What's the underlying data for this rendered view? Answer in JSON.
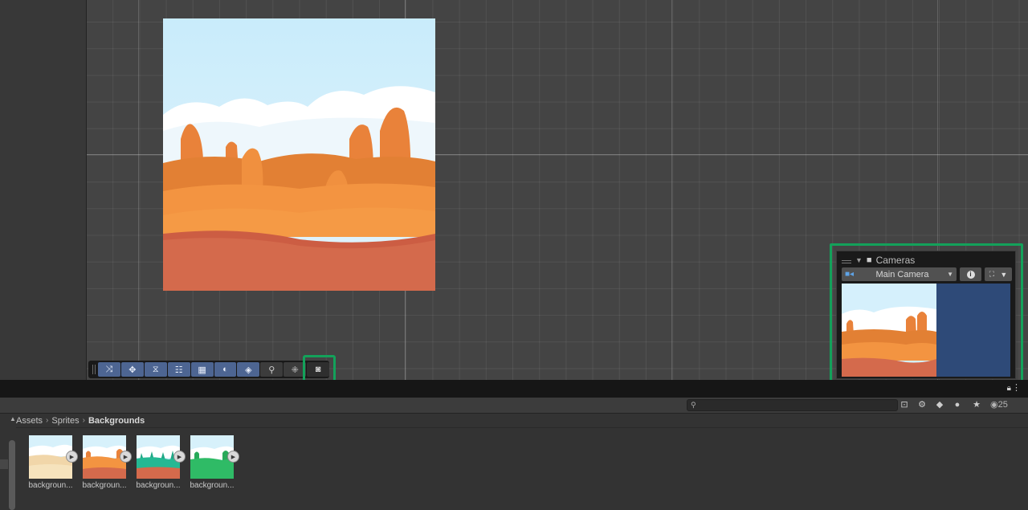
{
  "scene": {
    "toolbar": {
      "tools": [
        {
          "icon": "view-tool-icon",
          "glyph": "⤨",
          "active": true
        },
        {
          "icon": "move-tool-icon",
          "glyph": "✥",
          "active": true
        },
        {
          "icon": "rotate-tool-icon",
          "glyph": "⧖",
          "active": true
        },
        {
          "icon": "rect-tool-icon",
          "glyph": "☷",
          "active": true
        },
        {
          "icon": "grid-snap-icon",
          "glyph": "▦",
          "active": true
        },
        {
          "icon": "shading-mode-icon",
          "glyph": "◐",
          "active": true
        },
        {
          "icon": "gizmos-icon",
          "glyph": "◈",
          "active": true
        },
        {
          "icon": "search-scene-icon",
          "glyph": "⚲",
          "active": false
        },
        {
          "icon": "orientation-icon",
          "glyph": "⁜",
          "active": false
        },
        {
          "icon": "camera-overlay-icon",
          "glyph": "◙",
          "active": false,
          "selected": true
        }
      ]
    },
    "cameras_overlay": {
      "title": "Cameras",
      "selected_camera": "Main Camera",
      "accent_color": "#13a15a"
    }
  },
  "project": {
    "search_placeholder": "",
    "hidden_count": "25",
    "breadcrumb": [
      "Assets",
      "Sprites",
      "Backgrounds"
    ],
    "assets": [
      {
        "name": "backgroun...",
        "theme": "desert"
      },
      {
        "name": "backgroun...",
        "theme": "autumn"
      },
      {
        "name": "backgroun...",
        "theme": "teal"
      },
      {
        "name": "backgroun...",
        "theme": "green"
      }
    ]
  }
}
